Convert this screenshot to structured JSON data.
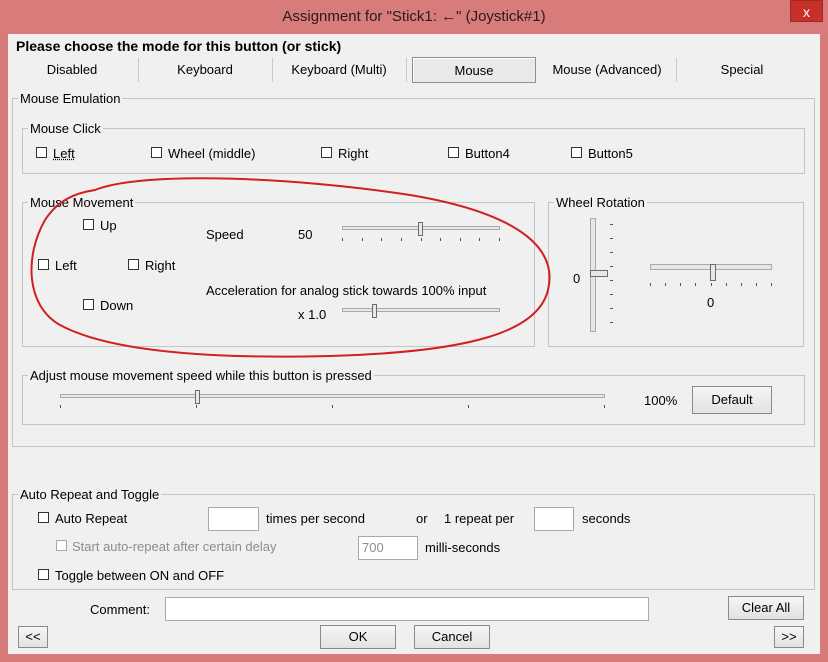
{
  "window": {
    "title": "Assignment for \"Stick1: ←\" (Joystick#1)",
    "close_glyph": "x"
  },
  "mode": {
    "heading": "Please choose the mode for this button (or stick)",
    "tabs": [
      "Disabled",
      "Keyboard",
      "Keyboard (Multi)",
      "Mouse",
      "Mouse (Advanced)",
      "Special"
    ],
    "selected": "Mouse"
  },
  "mouse_emulation": {
    "title": "Mouse Emulation",
    "click": {
      "title": "Mouse Click",
      "options": [
        "Left",
        "Wheel (middle)",
        "Right",
        "Button4",
        "Button5"
      ]
    },
    "movement": {
      "title": "Mouse Movement",
      "directions": {
        "up": "Up",
        "left": "Left",
        "right": "Right",
        "down": "Down"
      },
      "speed_label": "Speed",
      "speed_value": "50",
      "speed_level": 0.5,
      "accel_label": "Acceleration for analog stick towards 100% input",
      "accel_value": "x 1.0",
      "accel_level": 0.2
    },
    "wheel": {
      "title": "Wheel Rotation",
      "vertical_value": "0",
      "horizontal_value": "0"
    },
    "adjust": {
      "title": "Adjust mouse movement speed while this button is pressed",
      "value": "100%",
      "default_label": "Default",
      "level": 0.25
    }
  },
  "auto_repeat": {
    "title": "Auto Repeat and Toggle",
    "auto_repeat_label": "Auto Repeat",
    "times_label": "times per second",
    "or_label": "or",
    "repeat_per_label": "1 repeat per",
    "seconds_label": "seconds",
    "times_value": "",
    "seconds_value": "",
    "delay_label": "Start auto-repeat after certain delay",
    "delay_value": "700",
    "ms_label": "milli-seconds",
    "toggle_label": "Toggle between ON and OFF"
  },
  "footer": {
    "comment_label": "Comment:",
    "comment_value": "",
    "clear_all": "Clear All",
    "prev": "<<",
    "ok": "OK",
    "cancel": "Cancel",
    "next": ">>"
  },
  "colors": {
    "frame": "#d77a7a",
    "annotation": "#d21f1f",
    "client": "#f0f0f0"
  }
}
